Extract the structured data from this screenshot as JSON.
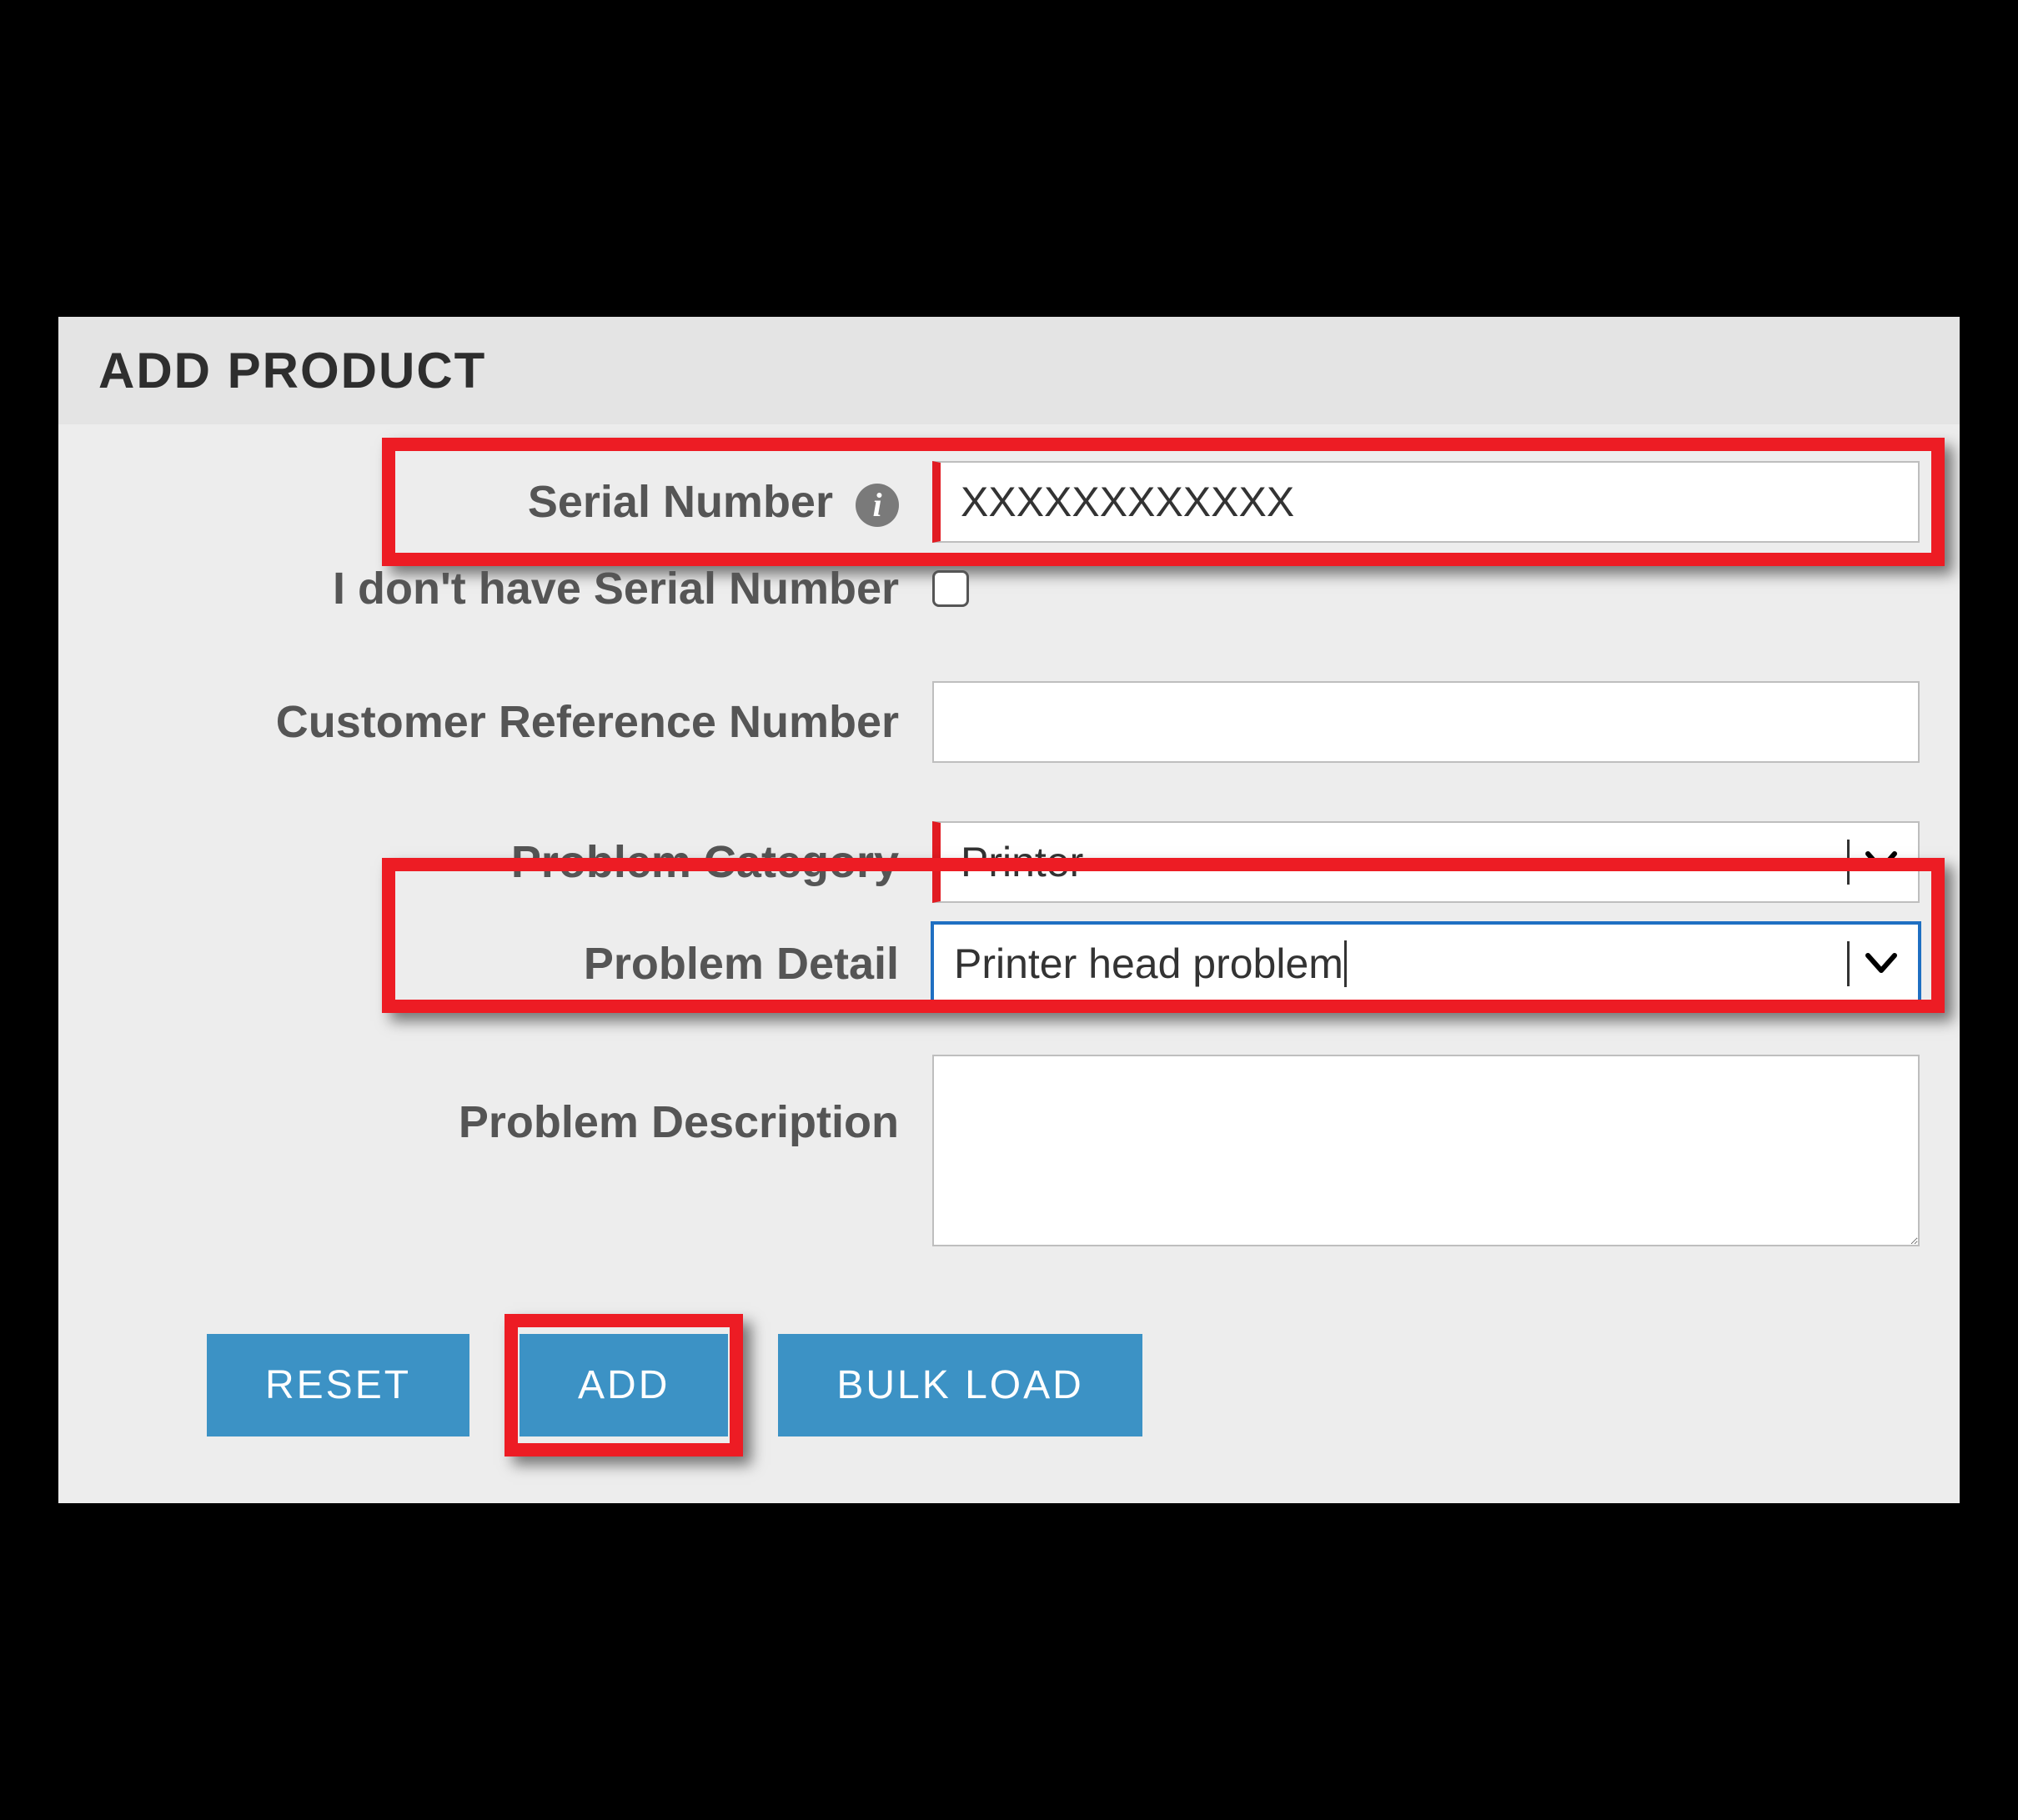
{
  "header": {
    "title": "ADD PRODUCT"
  },
  "fields": {
    "serial_label": "Serial Number",
    "serial_value": "XXXXXXXXXXXX",
    "no_serial_label": "I don't have Serial Number",
    "no_serial_checked": false,
    "cust_ref_label": "Customer Reference Number",
    "cust_ref_value": "",
    "category_label": "Problem Category",
    "category_value": "Printer",
    "detail_label": "Problem Detail",
    "detail_value": "Printer head problem",
    "desc_label": "Problem Description",
    "desc_value": ""
  },
  "buttons": {
    "reset": "RESET",
    "add": "ADD",
    "bulk": "BULK LOAD"
  },
  "colors": {
    "accent_button": "#3c92c5",
    "highlight": "#ed1c24",
    "required_bar": "#e11b22"
  },
  "icons": {
    "info": "info-icon",
    "chevron_down": "chevron-down-icon"
  }
}
